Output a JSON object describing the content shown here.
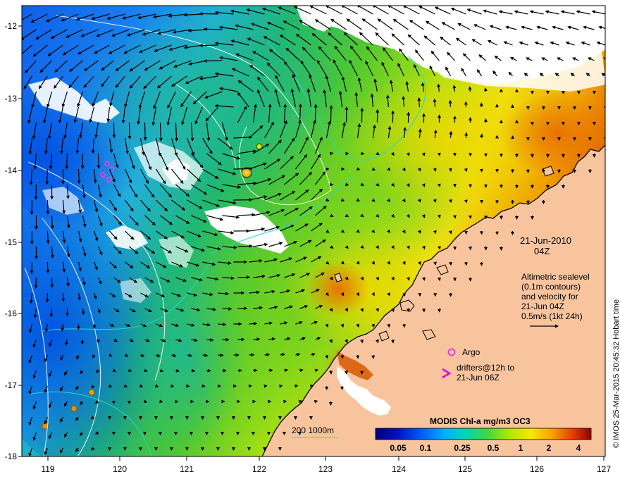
{
  "map": {
    "date": "21-Jun-2010",
    "time": "04Z",
    "legend_lines": [
      "Altimetric sealevel",
      "(0.1m contours)",
      "and velocity for",
      "21-Jun 04Z",
      "0.5m/s (1kt 24h)"
    ],
    "argo_label": "Argo",
    "drifters_lines": [
      "drifters@12h to",
      "21-Jun 06Z"
    ],
    "depth_label": "200  1000m",
    "colorbar_title": "MODIS Chl-a mg/m3 OC3",
    "colorbar_ticks": [
      "0.05",
      "0.1",
      "0.25",
      "0.5",
      "1",
      "2",
      "4"
    ],
    "credit": "© IMOS 25-Mar-2015 20:45:32 Hobart time",
    "x_ticks": [
      "119",
      "120",
      "121",
      "122",
      "123",
      "124",
      "125",
      "126",
      "127"
    ],
    "y_ticks": [
      "-12",
      "-13",
      "-14",
      "-15",
      "-16",
      "-17",
      "-18"
    ],
    "colors": {
      "land": "#f7c49e",
      "argo": "#e040e0",
      "drifter": "#e000e0",
      "contour": "#ffffff",
      "isobath_200": "#28d8c8",
      "cloud": "#ffffff"
    }
  }
}
